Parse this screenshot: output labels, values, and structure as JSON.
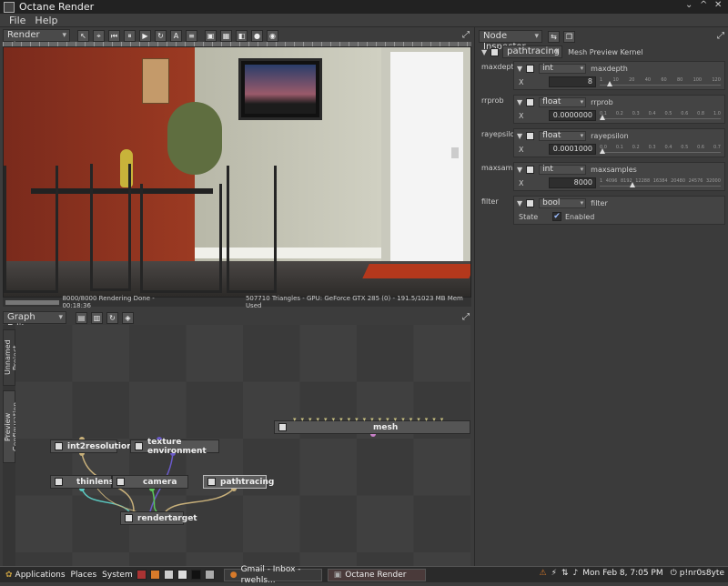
{
  "window": {
    "title": "Octane Render",
    "controls": [
      "⌄",
      "^",
      "✕"
    ]
  },
  "menu": {
    "items": [
      "File",
      "Help"
    ]
  },
  "render_viewport": {
    "dropdown_label": "Render Viewport",
    "status_left": "8000/8000 Rendering Done - 00:18:36",
    "status_right": "507710 Triangles - GPU: GeForce GTX 285 (0) - 191.5/1023 MB Mem Used"
  },
  "graph_editor": {
    "dropdown_label": "Graph Editor",
    "vtabs": [
      "Unnamed Project",
      "Preview Configuration"
    ],
    "nodes": {
      "mesh": "mesh",
      "int2resolution": "int2resolution",
      "texture_environment": "texture environment",
      "thinlens": "thinlens",
      "camera": "camera",
      "pathtracing": "pathtracing",
      "rendertarget": "rendertarget"
    }
  },
  "node_inspector": {
    "dropdown_label": "Node Inspector",
    "kernel_dropdown": "pathtracing",
    "kernel_label": "Mesh Preview Kernel",
    "params": [
      {
        "label": "maxdepth",
        "type": "int",
        "name": "maxdepth",
        "value_label": "X",
        "value": "8",
        "ticks": [
          "1",
          "10",
          "20",
          "40",
          "60",
          "80",
          "100",
          "120"
        ],
        "fraction": 0.06
      },
      {
        "label": "rrprob",
        "type": "float",
        "name": "rrprob",
        "value_label": "X",
        "value": "0.0000000",
        "ticks": [
          "0.1",
          "0.2",
          "0.3",
          "0.4",
          "0.5",
          "0.6",
          "0.8",
          "1.0"
        ],
        "fraction": 0.0
      },
      {
        "label": "rayepsilon",
        "type": "float",
        "name": "rayepsilon",
        "value_label": "X",
        "value": "0.0001000",
        "ticks": [
          "0.0",
          "0.1",
          "0.2",
          "0.3",
          "0.4",
          "0.5",
          "0.6",
          "0.7"
        ],
        "fraction": 0.0
      },
      {
        "label": "maxsamples",
        "type": "int",
        "name": "maxsamples",
        "value_label": "X",
        "value": "8000",
        "ticks": [
          "1",
          "4096",
          "8192",
          "12288",
          "16384",
          "20480",
          "24576",
          "32000"
        ],
        "fraction": 0.25
      }
    ],
    "filter": {
      "label": "filter",
      "type": "bool",
      "name": "filter",
      "state_label": "State",
      "state_value": "Enabled"
    }
  },
  "taskbar": {
    "applications": "Applications",
    "places": "Places",
    "system": "System",
    "tasks": [
      "Gmail - Inbox - rwehls...",
      "Octane Render"
    ],
    "clock": "Mon Feb  8,  7:05 PM",
    "user": "p!nr0s8yte"
  }
}
